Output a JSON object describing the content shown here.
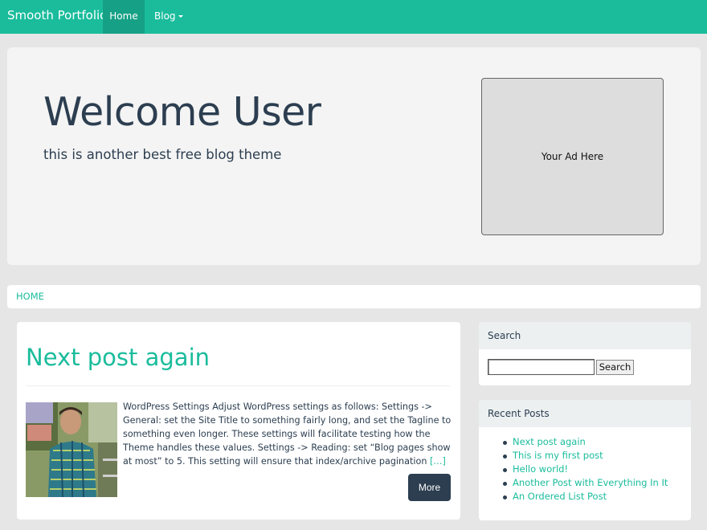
{
  "navbar": {
    "brand": "Smooth Portfolio",
    "items": [
      {
        "label": "Home"
      },
      {
        "label": "Blog"
      }
    ]
  },
  "jumbotron": {
    "title": "Welcome User",
    "tagline": "this is another best free blog theme",
    "ad_text": "Your Ad Here"
  },
  "breadcrumb": {
    "home": "HOME"
  },
  "post": {
    "title": "Next post again",
    "excerpt": "WordPress Settings Adjust WordPress settings as follows: Settings -> General: set the Site Title to something fairly long, and set the Tagline to something even longer. These settings will facilitate testing how the Theme handles these values. Settings -> Reading: set “Blog pages show at most” to 5. This setting will ensure that index/archive pagination",
    "ellipsis": "[…]",
    "more_label": "More"
  },
  "sidebar": {
    "search": {
      "title": "Search",
      "button_label": "Search",
      "value": ""
    },
    "recent": {
      "title": "Recent Posts",
      "items": [
        "Next post again",
        "This is my first post",
        "Hello world!",
        "Another Post with Everything In It",
        "An Ordered List Post"
      ]
    }
  },
  "colors": {
    "accent": "#1abc9c",
    "accent_dark": "#16a085",
    "primary": "#2c3e50",
    "page_bg": "#e6e6e6"
  }
}
